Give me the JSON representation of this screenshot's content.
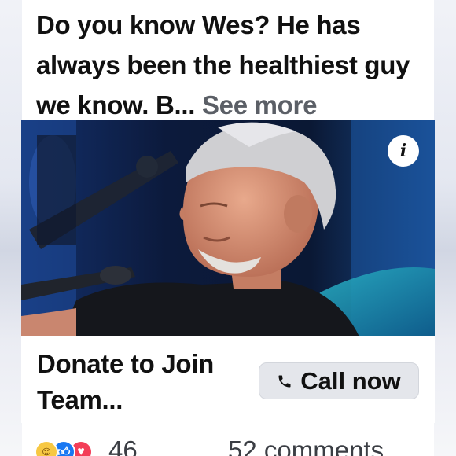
{
  "post": {
    "text": "Do you know Wes? He has always been the healthiest guy we know. B...",
    "see_more": "See more"
  },
  "media": {
    "info_symbol": "i",
    "info_icon": "info-icon"
  },
  "cta": {
    "title": "Donate to Join Team...",
    "button_label": "Call now",
    "button_icon": "phone-icon"
  },
  "engagement": {
    "reaction_icons": [
      "haha-reaction-icon",
      "like-reaction-icon",
      "love-reaction-icon"
    ],
    "reaction_count": "46",
    "comments_label": "52 comments"
  },
  "colors": {
    "button_bg": "#e4e6eb",
    "text": "#111111",
    "see_more": "#5b5f66",
    "like": "#1877f2",
    "love": "#f33e58",
    "haha": "#f7c843"
  }
}
